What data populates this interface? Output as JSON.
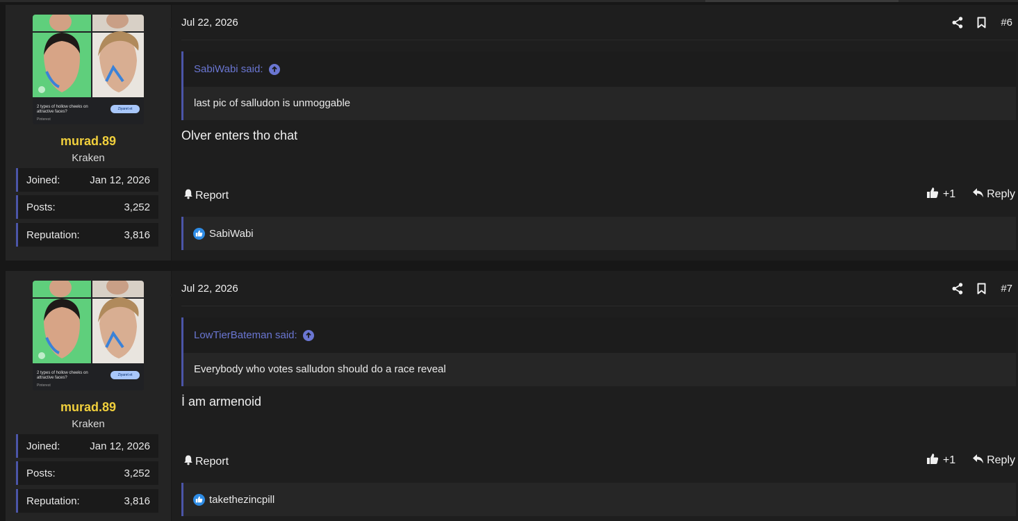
{
  "posts": [
    {
      "user": {
        "avatar_text": "2 types of hollow cheeks on attractive faces?",
        "avatar_source": "Pinterest",
        "avatar_button": "Ziyaret et",
        "name": "murad.89",
        "title": "Kraken",
        "stats": [
          {
            "label": "Joined:",
            "value": "Jan 12, 2026"
          },
          {
            "label": "Posts:",
            "value": "3,252"
          },
          {
            "label": "Reputation:",
            "value": "3,816"
          }
        ]
      },
      "date": "Jul 22, 2026",
      "number": "#6",
      "quote": {
        "author": "SabiWabi said:",
        "text": "last pic of salludon is unmoggable"
      },
      "message": "Olver enters tho chat",
      "report_label": "Report",
      "like_count": "+1",
      "reply_label": "Reply",
      "reaction_user": "SabiWabi"
    },
    {
      "user": {
        "avatar_text": "2 types of hollow cheeks on attractive faces?",
        "avatar_source": "Pinterest",
        "avatar_button": "Ziyaret et",
        "name": "murad.89",
        "title": "Kraken",
        "stats": [
          {
            "label": "Joined:",
            "value": "Jan 12, 2026"
          },
          {
            "label": "Posts:",
            "value": "3,252"
          },
          {
            "label": "Reputation:",
            "value": "3,816"
          }
        ]
      },
      "date": "Jul 22, 2026",
      "number": "#7",
      "quote": {
        "author": "LowTierBateman said:",
        "text": "Everybody who votes salludon should do a race reveal"
      },
      "message": "İ am armenoid",
      "report_label": "Report",
      "like_count": "+1",
      "reply_label": "Reply",
      "reaction_user": "takethezincpill"
    }
  ],
  "colors": {
    "username": "#f0cf3c",
    "quote_accent": "#4b55a8",
    "quote_author": "#6a76d2",
    "like_reaction": "#2e8ce6"
  }
}
